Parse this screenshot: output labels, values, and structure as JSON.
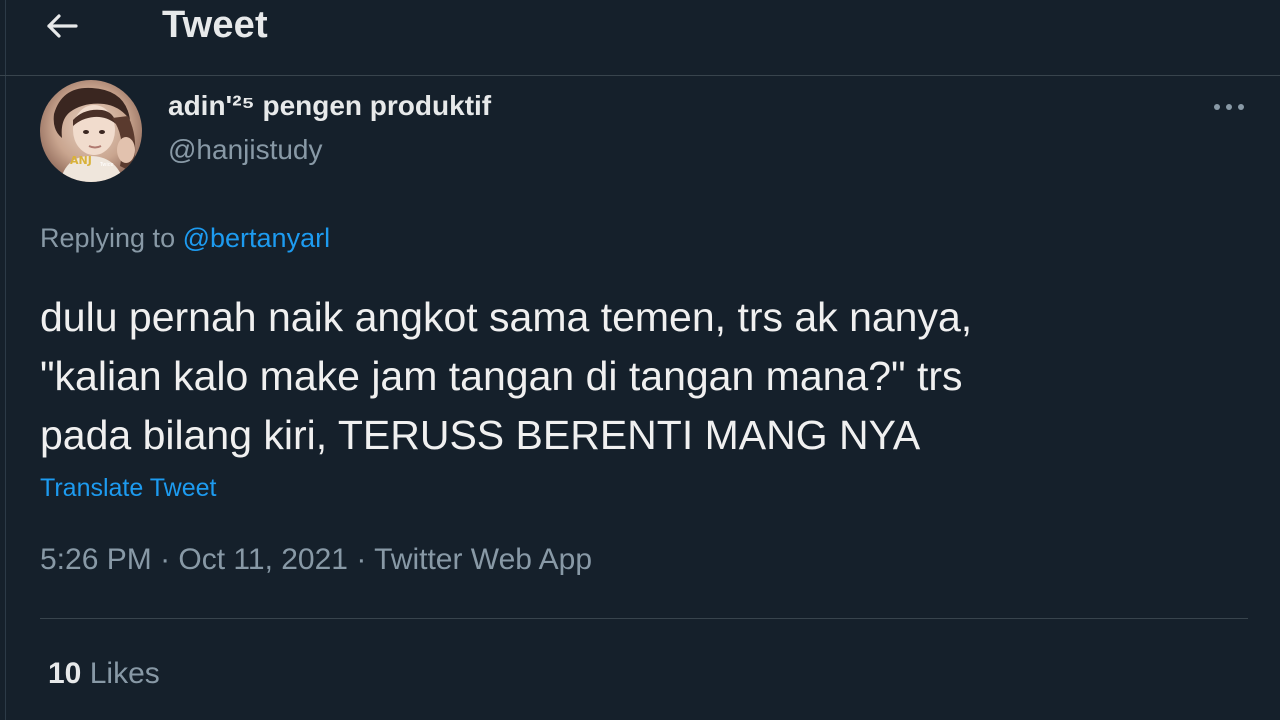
{
  "header": {
    "title": "Tweet",
    "back_icon": "arrow-left-icon"
  },
  "author": {
    "display_name": "adin'²⁵ pengen produktif",
    "handle": "@hanjistudy",
    "avatar_icon": "profile-photo",
    "more_icon": "more-horizontal-icon"
  },
  "tweet": {
    "replying_prefix": "Replying to",
    "replying_to": "@bertanyarl",
    "text": "dulu pernah naik angkot sama temen, trs ak nanya,\n\"kalian kalo make jam tangan di tangan mana?\" trs\npada bilang kiri, TERUSS BERENTI MANG NYA",
    "translate_label": "Translate Tweet",
    "time": "5:26 PM",
    "date": "Oct 11, 2021",
    "source": "Twitter Web App",
    "separator": "·"
  },
  "stats": {
    "likes_count": "10",
    "likes_label": "Likes"
  },
  "colors": {
    "background": "#15202b",
    "accent": "#1d9bf0",
    "muted": "#8899a6",
    "text": "#e7e9ea",
    "border": "#38444d"
  }
}
